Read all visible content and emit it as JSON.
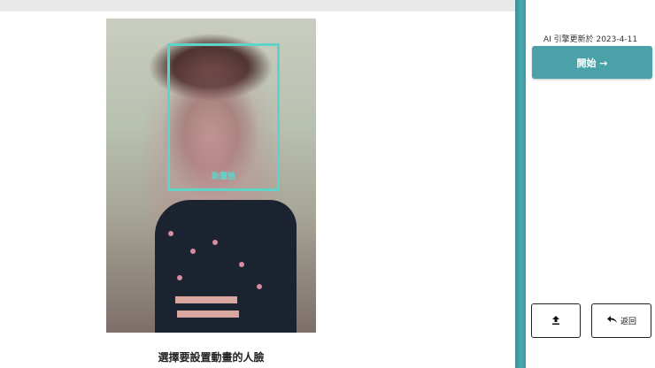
{
  "photo": {
    "face_label": "動畫臉"
  },
  "caption": "選擇要設置動畫的人臉",
  "sidebar": {
    "engine_update": "AI 引擎更新於 2023-4-11",
    "start_label": "開始 →",
    "back_label": "返回"
  },
  "colors": {
    "accent": "#4aa2a8",
    "face_box": "#5ed4c9",
    "divider": "#3e9aa0"
  },
  "icons": {
    "upload": "upload-icon",
    "back": "undo-icon"
  }
}
